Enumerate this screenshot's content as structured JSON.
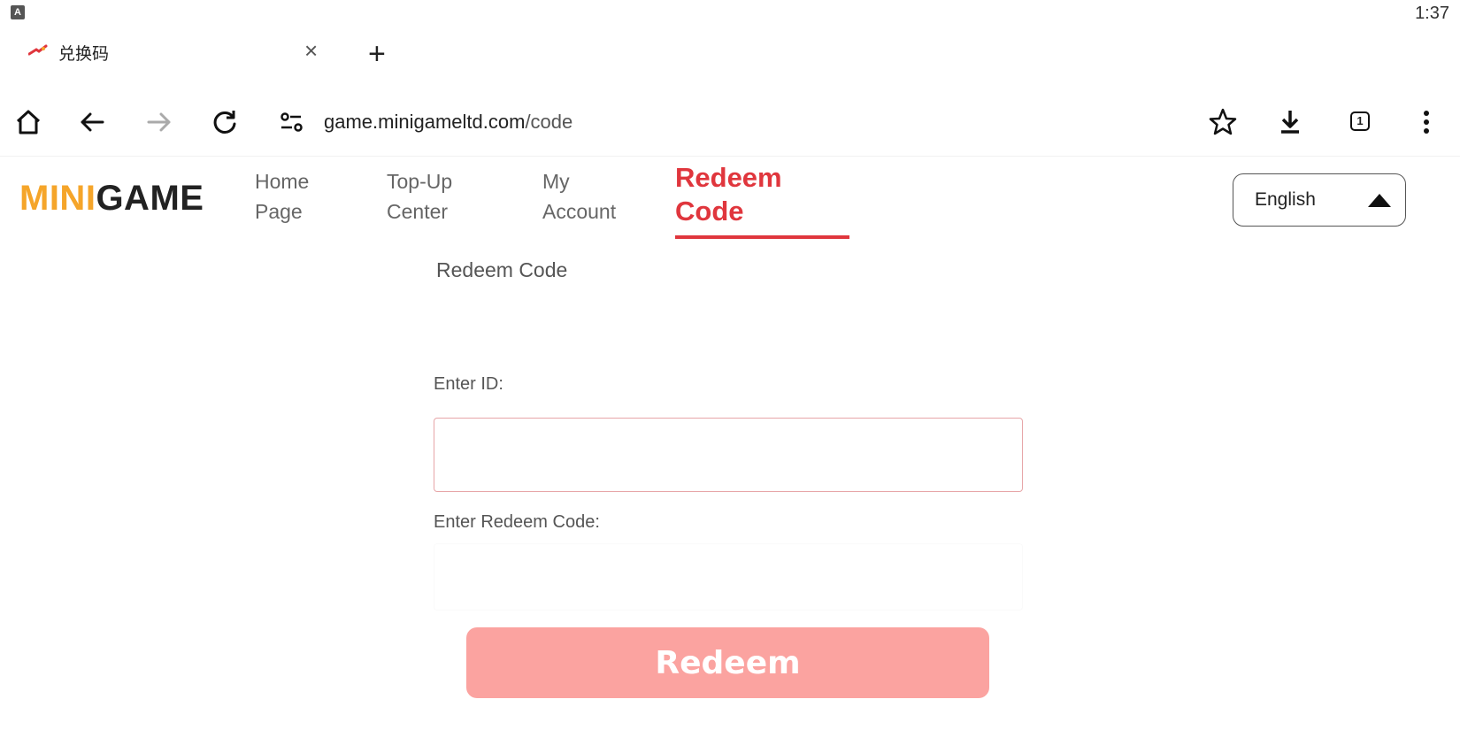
{
  "status_bar": {
    "app_icon_letter": "A",
    "time": "1:37"
  },
  "tab": {
    "title": "兑换码",
    "close_glyph": "×",
    "new_tab_glyph": "+"
  },
  "toolbar": {
    "url_host": "game.minigameltd.com",
    "url_path": "/code",
    "tab_count": "1"
  },
  "site": {
    "logo_part1": "MINI",
    "logo_part2": "GAME",
    "nav": [
      {
        "line1": "Home",
        "line2": "Page"
      },
      {
        "line1": "Top-Up",
        "line2": "Center"
      },
      {
        "line1": "My",
        "line2": "Account"
      },
      {
        "line1": "Redeem",
        "line2": "Code"
      }
    ],
    "active_nav": "Redeem Code",
    "language": "English"
  },
  "form": {
    "section_title": "Redeem Code",
    "id_label": "Enter ID:",
    "id_value": "",
    "code_label": "Enter Redeem Code:",
    "code_value": "",
    "submit_label": "Redeem"
  },
  "colors": {
    "accent_red": "#e0363d",
    "logo_orange": "#f5a52a",
    "button_bg": "#fba3a0",
    "input_border": "#e7a6a8"
  }
}
